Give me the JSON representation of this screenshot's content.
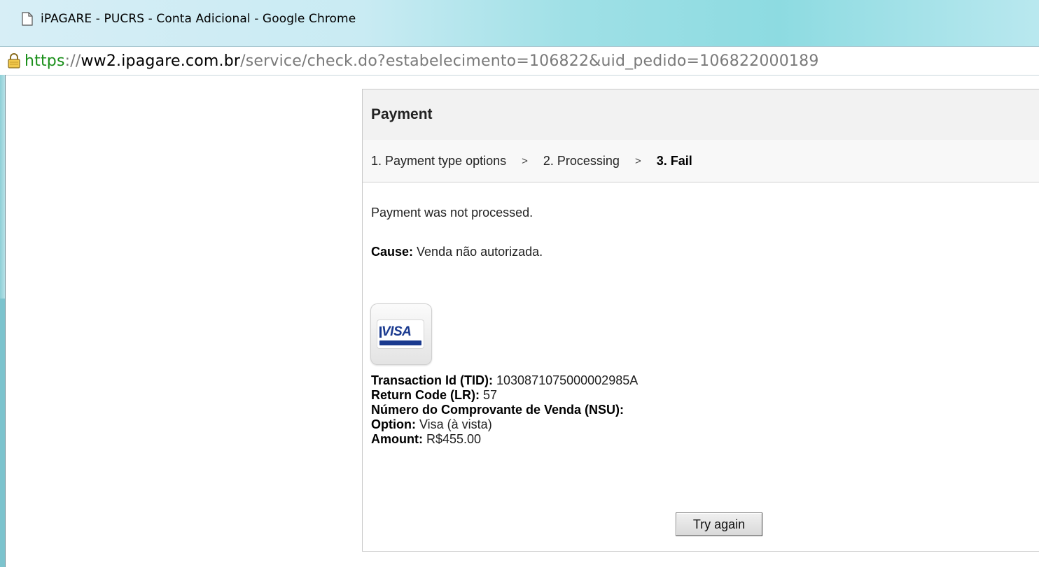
{
  "window": {
    "title": "iPAGARE - PUCRS - Conta Adicional - Google Chrome"
  },
  "address": {
    "scheme": "https",
    "separator": "://",
    "host": "ww2.ipagare.com.br",
    "path": "/service/check.do?estabelecimento=106822&uid_pedido=106822000189"
  },
  "panel": {
    "title": "Payment",
    "steps": [
      {
        "label": "1. Payment type options"
      },
      {
        "label": "2. Processing"
      },
      {
        "label": "3. Fail"
      }
    ],
    "step_separator": ">",
    "message": "Payment was not processed.",
    "cause_label": "Cause:",
    "cause_value": " Venda não autorizada.",
    "card_brand": "VISA",
    "details": [
      {
        "label": "Transaction Id (TID):",
        "value": " 1030871075000002985A"
      },
      {
        "label": "Return Code (LR):",
        "value": " 57"
      },
      {
        "label": "Número do Comprovante de Venda (NSU):",
        "value": ""
      },
      {
        "label": "Option:",
        "value": " Visa (à vista)"
      },
      {
        "label": "Amount:",
        "value": " R$455.00"
      }
    ],
    "try_again_label": "Try again"
  },
  "colors": {
    "https_green": "#1a8f1a",
    "visa_blue": "#1a3a8f"
  }
}
